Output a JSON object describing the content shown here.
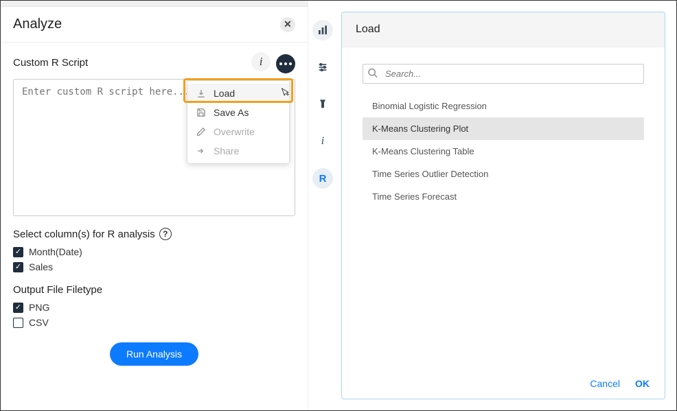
{
  "panel": {
    "title": "Analyze",
    "close": "✕"
  },
  "script": {
    "label": "Custom R Script",
    "placeholder": "Enter custom R script here..."
  },
  "dropdown": {
    "items": [
      {
        "label": "Load",
        "icon": "download",
        "highlight": true,
        "disabled": false
      },
      {
        "label": "Save As",
        "icon": "save",
        "highlight": false,
        "disabled": false
      },
      {
        "label": "Overwrite",
        "icon": "pencil",
        "highlight": false,
        "disabled": true
      },
      {
        "label": "Share",
        "icon": "share",
        "highlight": false,
        "disabled": true
      }
    ]
  },
  "columns": {
    "label": "Select column(s) for R analysis",
    "items": [
      {
        "label": "Month(Date)",
        "checked": true
      },
      {
        "label": "Sales",
        "checked": true
      }
    ]
  },
  "filetype": {
    "label": "Output File Filetype",
    "items": [
      {
        "label": "PNG",
        "checked": true
      },
      {
        "label": "CSV",
        "checked": false
      }
    ]
  },
  "run_label": "Run Analysis",
  "rail": {
    "r_label": "R"
  },
  "modal": {
    "title": "Load",
    "search_placeholder": "Search...",
    "items": [
      {
        "label": "Binomial Logistic Regression",
        "selected": false
      },
      {
        "label": "K-Means Clustering Plot",
        "selected": true
      },
      {
        "label": "K-Means Clustering Table",
        "selected": false
      },
      {
        "label": "Time Series Outlier Detection",
        "selected": false
      },
      {
        "label": "Time Series Forecast",
        "selected": false
      }
    ],
    "cancel": "Cancel",
    "ok": "OK"
  }
}
